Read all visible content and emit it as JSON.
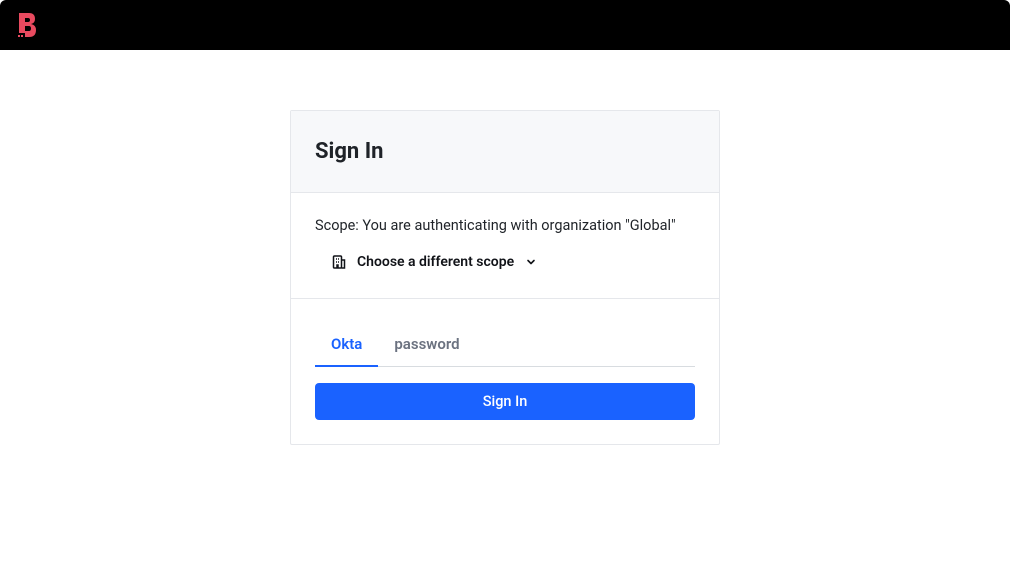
{
  "header": {
    "title": "Sign In"
  },
  "scope": {
    "text": "Scope: You are authenticating with organization \"Global\"",
    "selector_label": "Choose a different scope"
  },
  "tabs": {
    "okta": "Okta",
    "password": "password"
  },
  "button": {
    "signin": "Sign In"
  },
  "colors": {
    "primary": "#1a62ff",
    "logo": "#e84a5f"
  }
}
